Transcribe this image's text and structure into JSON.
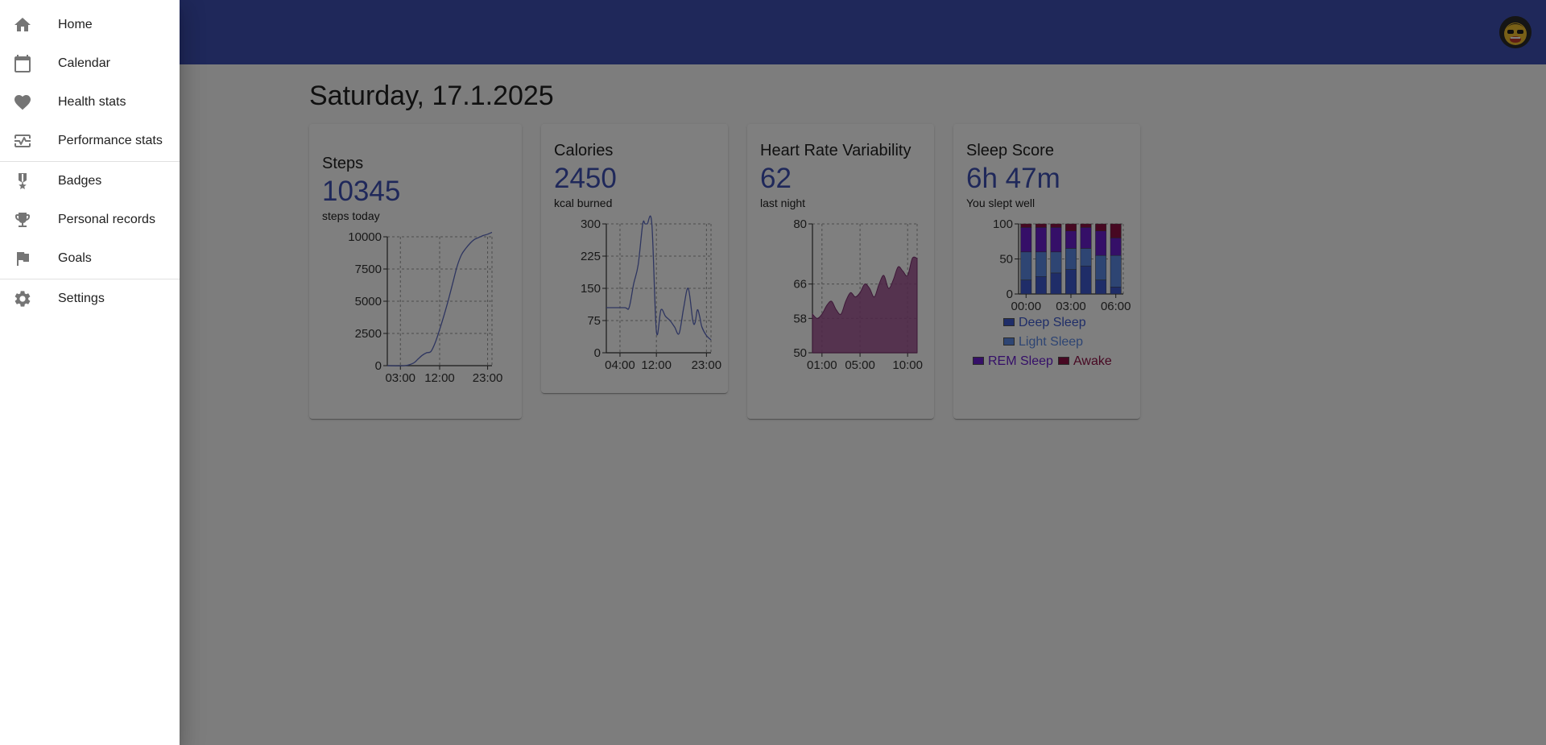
{
  "drawer": {
    "groups": [
      [
        {
          "label": "Home",
          "icon": "home-icon"
        },
        {
          "label": "Calendar",
          "icon": "calendar-icon"
        },
        {
          "label": "Health stats",
          "icon": "heart-icon"
        },
        {
          "label": "Performance stats",
          "icon": "monitor-heart-icon"
        }
      ],
      [
        {
          "label": "Badges",
          "icon": "badge-icon"
        },
        {
          "label": "Personal records",
          "icon": "trophy-icon"
        },
        {
          "label": "Goals",
          "icon": "flag-icon"
        }
      ],
      [
        {
          "label": "Settings",
          "icon": "gear-icon"
        }
      ]
    ]
  },
  "header": {
    "avatar_icon": "avatar-emoji-icon",
    "color": "#3f51b5"
  },
  "page": {
    "date": "Saturday, 17.1.2025"
  },
  "cards": {
    "steps": {
      "title": "Steps",
      "value": "10345",
      "subtitle": "steps today"
    },
    "calories": {
      "title": "Calories",
      "value": "2450",
      "subtitle": "kcal burned"
    },
    "hrv": {
      "title": "Heart Rate Variability",
      "value": "62",
      "subtitle": "last night"
    },
    "sleep": {
      "title": "Sleep Score",
      "value": "6h 47m",
      "subtitle": "You slept well"
    }
  },
  "colors": {
    "accent": "#3f51b5",
    "line": "#5c6bc0",
    "area": "#9c4b8e"
  },
  "chart_data": [
    {
      "id": "steps",
      "type": "line",
      "x_ticks": [
        "03:00",
        "12:00",
        "23:00"
      ],
      "x_tick_hours": [
        3,
        12,
        23
      ],
      "xlim": [
        0,
        24
      ],
      "ylim": [
        0,
        10000
      ],
      "y_ticks": [
        0,
        2500,
        5000,
        7500,
        10000
      ],
      "x": [
        0,
        4,
        6,
        7,
        8,
        9,
        10,
        11,
        12,
        13,
        14,
        15,
        16,
        17,
        18,
        19,
        20,
        21,
        22,
        23,
        24
      ],
      "values": [
        0,
        0,
        200,
        500,
        800,
        1000,
        1100,
        1800,
        2800,
        3900,
        5100,
        6400,
        7700,
        8600,
        9100,
        9500,
        9800,
        9950,
        10100,
        10200,
        10345
      ],
      "grid": true
    },
    {
      "id": "calories",
      "type": "line",
      "x_ticks": [
        "04:00",
        "12:00",
        "23:00"
      ],
      "x_tick_hours": [
        4,
        12,
        23
      ],
      "xlim": [
        1,
        24
      ],
      "ylim": [
        0,
        300
      ],
      "y_ticks": [
        0,
        75,
        150,
        225,
        300
      ],
      "x": [
        1,
        5,
        6,
        7,
        8,
        9,
        9.5,
        10,
        11,
        12,
        13,
        14,
        15,
        16,
        17,
        18,
        19,
        20,
        20.5,
        21,
        21.5,
        22,
        23,
        24
      ],
      "values": [
        105,
        105,
        105,
        160,
        205,
        300,
        300,
        300,
        300,
        50,
        100,
        85,
        75,
        60,
        45,
        105,
        150,
        75,
        70,
        100,
        85,
        60,
        40,
        30
      ],
      "grid": true
    },
    {
      "id": "hrv",
      "type": "area",
      "x_ticks": [
        "01:00",
        "05:00",
        "10:00"
      ],
      "x_tick_hours": [
        1,
        5,
        10
      ],
      "xlim": [
        0,
        11
      ],
      "ylim": [
        50,
        80
      ],
      "y_ticks": [
        50,
        58,
        66,
        80
      ],
      "x": [
        0,
        0.5,
        1,
        1.5,
        2,
        2.5,
        3,
        3.5,
        4,
        4.5,
        5,
        5.5,
        6,
        6.5,
        7,
        7.5,
        8,
        8.5,
        9,
        9.5,
        10,
        10.5,
        11
      ],
      "values": [
        59,
        58,
        59,
        61,
        62,
        60,
        59,
        62,
        64,
        63,
        64,
        66,
        65,
        63,
        66,
        68,
        65,
        67,
        70,
        69,
        68,
        72,
        72
      ],
      "grid": true
    },
    {
      "id": "sleep",
      "type": "bar",
      "stacked": true,
      "categories": [
        "00:00",
        "01:00",
        "02:00",
        "03:00",
        "04:00",
        "05:00",
        "06:00"
      ],
      "x_ticks": [
        "00:00",
        "03:00",
        "06:00"
      ],
      "ylim": [
        0,
        100
      ],
      "y_ticks": [
        0,
        50,
        100
      ],
      "series": [
        {
          "name": "Deep Sleep",
          "color": "#3f5bd1",
          "values": [
            20,
            25,
            30,
            35,
            40,
            20,
            10
          ]
        },
        {
          "name": "Light Sleep",
          "color": "#5c8ae6",
          "values": [
            40,
            35,
            30,
            30,
            25,
            35,
            45
          ]
        },
        {
          "name": "REM Sleep",
          "color": "#6a1fd1",
          "values": [
            35,
            35,
            35,
            25,
            30,
            35,
            25
          ]
        },
        {
          "name": "Awake",
          "color": "#8e1045",
          "values": [
            5,
            5,
            5,
            10,
            5,
            10,
            20
          ]
        }
      ],
      "legend": "bottom",
      "grid": true
    }
  ]
}
